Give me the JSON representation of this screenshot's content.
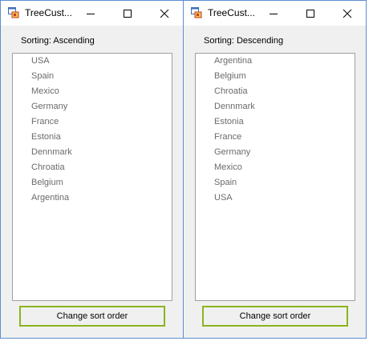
{
  "windows": [
    {
      "title": "TreeCust...",
      "sorting_label": "Sorting: Ascending",
      "nodes": [
        "USA",
        "Spain",
        "Mexico",
        "Germany",
        "France",
        "Estonia",
        "Dennmark",
        "Chroatia",
        "Belgium",
        "Argentina"
      ],
      "button_label": "Change sort order"
    },
    {
      "title": "TreeCust...",
      "sorting_label": "Sorting: Descending",
      "nodes": [
        "Argentina",
        "Belgium",
        "Chroatia",
        "Dennmark",
        "Estonia",
        "France",
        "Germany",
        "Mexico",
        "Spain",
        "USA"
      ],
      "button_label": "Change sort order"
    }
  ],
  "colors": {
    "window_border": "#5b8ed1",
    "button_border": "#8cb41e",
    "node_text": "#6b6b6b"
  },
  "icons": {
    "app": "app-window-icon",
    "minimize": "minimize-icon",
    "maximize": "maximize-icon",
    "close": "close-icon"
  }
}
